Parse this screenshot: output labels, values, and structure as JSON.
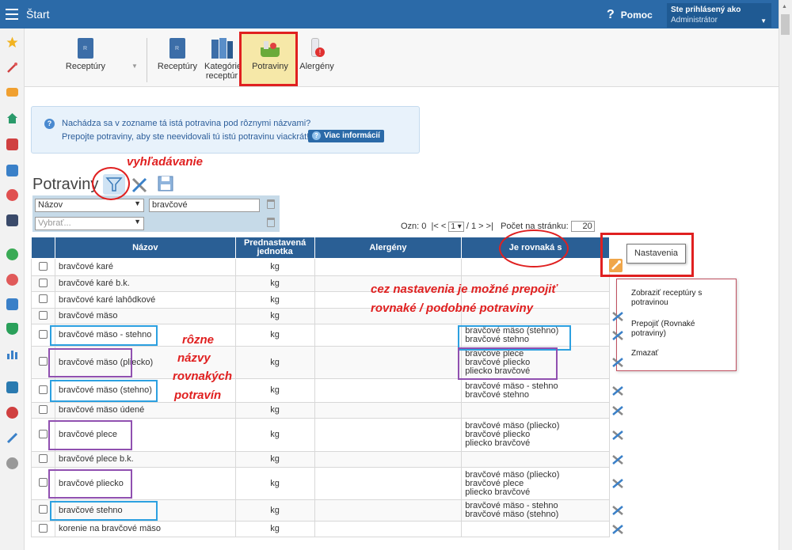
{
  "app": {
    "title": "Štart",
    "help_label": "Pomoc"
  },
  "user": {
    "line1": "Ste prihlásený ako",
    "line2": "Administrátor"
  },
  "ribbon": {
    "items": [
      {
        "label": "Receptúry"
      },
      {
        "label": "Receptúry"
      },
      {
        "label": "Kategórie receptúr"
      },
      {
        "label": "Potraviny"
      },
      {
        "label": "Alergény"
      }
    ]
  },
  "info": {
    "line1": "Nachádza sa v zozname tá istá potravina pod rôznymi názvami?",
    "line2": "Prepojte potraviny, aby ste neevidovali tú istú potravinu viackrát!",
    "button": "Viac informácií"
  },
  "page": {
    "title": "Potraviny"
  },
  "filter": {
    "field": "Názov",
    "value": "bravčové",
    "second_placeholder": "Vybrať..."
  },
  "pager": {
    "ozn_label": "Ozn:",
    "ozn_value": "0",
    "first": "|<",
    "prev": "<",
    "page": "1",
    "of": "/",
    "total": "1",
    "next": ">",
    "last": ">|",
    "per_page_label": "Počet na stránku:",
    "per_page": "20"
  },
  "grid": {
    "headers": [
      "Názov",
      "Prednastavená jednotka",
      "Alergény",
      "Je rovnaká s"
    ],
    "rows": [
      {
        "name": "bravčové karé",
        "unit": "kg",
        "allergens": "",
        "same": []
      },
      {
        "name": "bravčové karé b.k.",
        "unit": "kg",
        "allergens": "",
        "same": []
      },
      {
        "name": "bravčové karé lahôdkové",
        "unit": "kg",
        "allergens": "",
        "same": []
      },
      {
        "name": "bravčové mäso",
        "unit": "kg",
        "allergens": "",
        "same": []
      },
      {
        "name": "bravčové mäso - stehno",
        "unit": "kg",
        "allergens": "",
        "same": [
          "bravčové mäso (stehno)",
          "bravčové stehno"
        ]
      },
      {
        "name": "bravčové mäso (pliecko)",
        "unit": "kg",
        "allergens": "",
        "same": [
          "bravčové plece",
          "bravčové pliecko",
          "pliecko bravčové"
        ]
      },
      {
        "name": "bravčové mäso (stehno)",
        "unit": "kg",
        "allergens": "",
        "same": [
          "bravčové mäso - stehno",
          "bravčové stehno"
        ]
      },
      {
        "name": "bravčové mäso údené",
        "unit": "kg",
        "allergens": "",
        "same": []
      },
      {
        "name": "bravčové plece",
        "unit": "kg",
        "allergens": "",
        "same": [
          "bravčové mäso (pliecko)",
          "bravčové pliecko",
          "pliecko bravčové"
        ]
      },
      {
        "name": "bravčové plece b.k.",
        "unit": "kg",
        "allergens": "",
        "same": []
      },
      {
        "name": "bravčové pliecko",
        "unit": "kg",
        "allergens": "",
        "same": [
          "bravčové mäso (pliecko)",
          "bravčové plece",
          "pliecko bravčové"
        ]
      },
      {
        "name": "bravčové stehno",
        "unit": "kg",
        "allergens": "",
        "same": [
          "bravčové mäso - stehno",
          "bravčové mäso (stehno)"
        ]
      },
      {
        "name": "korenie na bravčové mäso",
        "unit": "kg",
        "allergens": "",
        "same": []
      }
    ]
  },
  "settings": {
    "tooltip": "Nastavenia",
    "menu": [
      "Zobraziť receptúry s potravinou",
      "Prepojiť (Rovnaké potraviny)",
      "Zmazať"
    ]
  },
  "annotations": {
    "search": "vyhľadávanie",
    "settings_line1": "cez nastavenia je možné prepojiť",
    "settings_line2": "rovnaké / podobné potraviny",
    "names": [
      "rôzne",
      "názvy",
      "rovnakých",
      "potravín"
    ]
  },
  "colors": {
    "topbar": "#2b6aa8",
    "header": "#2a5f95",
    "annotation": "#e02020",
    "highlight_blue": "#2ca0e0",
    "highlight_purple": "#9050b0"
  }
}
